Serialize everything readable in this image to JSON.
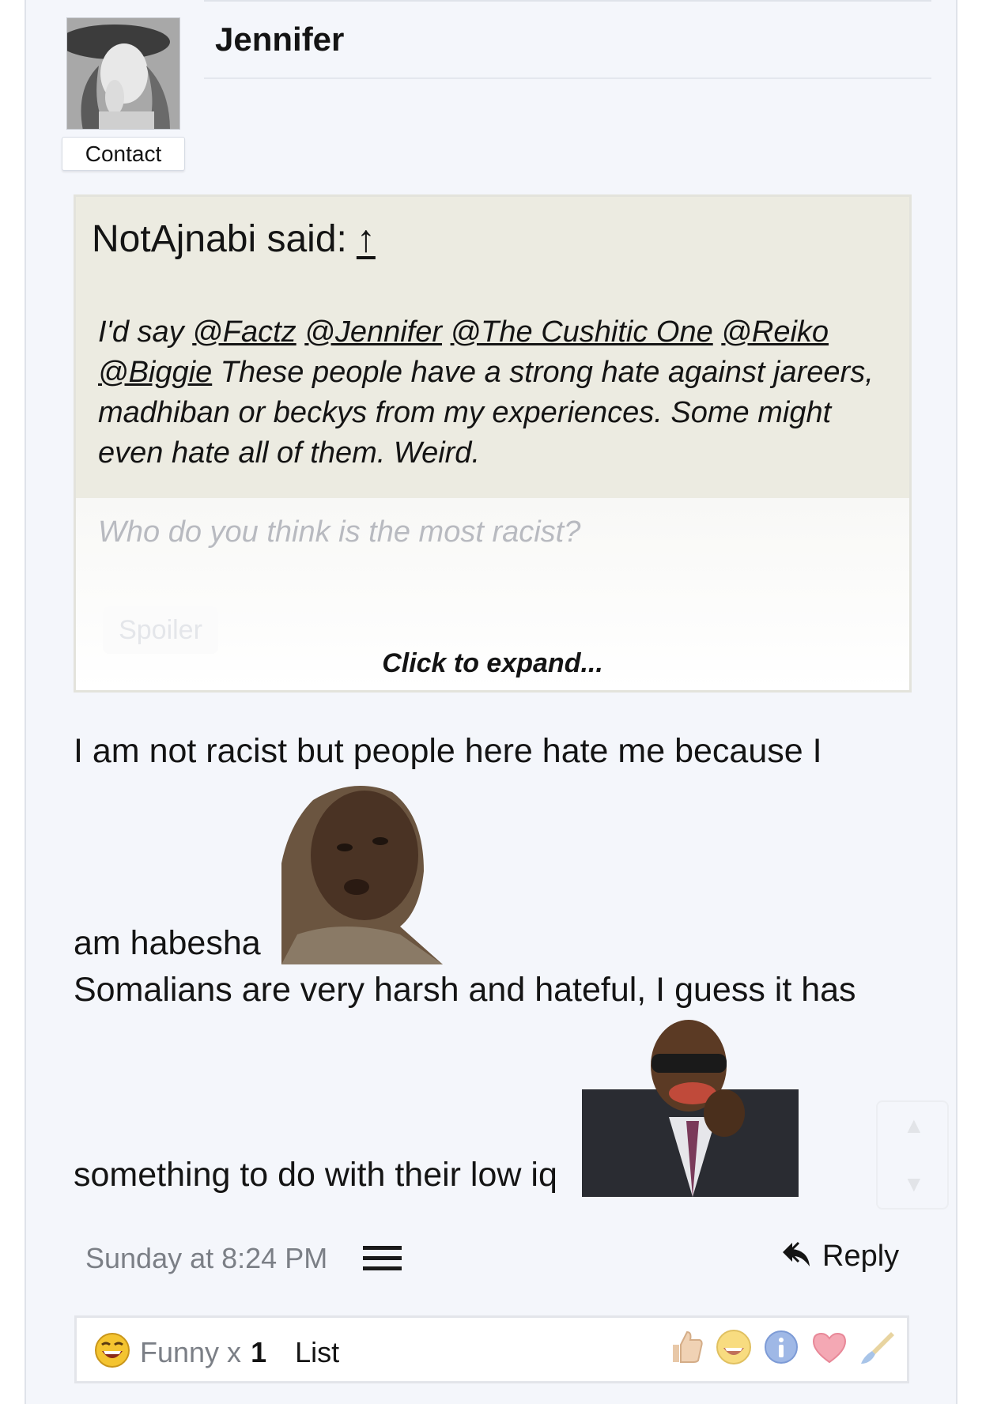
{
  "post": {
    "username": "Jennifer",
    "contact_label": "Contact",
    "quote": {
      "author": "NotAjnabi said:",
      "arrow": "↑",
      "prefix": "I'd say ",
      "mentions": [
        "@Factz",
        "@Jennifer",
        "@The Cushitic One",
        "@Reiko",
        "@Biggie"
      ],
      "body": " These people have a strong hate against jareers, madhiban or beckys from my experiences. Some might even hate all of them. Weird.",
      "hidden_text": "Who do you think is the most racist?",
      "spoiler_label": "Spoiler",
      "expand_label": "Click to expand..."
    },
    "message": {
      "line1": "I am not racist but people here hate me because I",
      "line2": "am habesha",
      "line3": "Somalians are very harsh and hateful, I guess it has",
      "line4": "something to do with their low iq"
    },
    "timestamp": "Sunday at 8:24 PM",
    "reply_label": "Reply",
    "rating": {
      "funny_label": "Funny x",
      "funny_count": "1",
      "list_label": "List"
    }
  },
  "icons": [
    "menu-icon",
    "reply-icon",
    "funny-icon",
    "like-icon",
    "info-icon",
    "heart-icon",
    "brush-icon"
  ]
}
